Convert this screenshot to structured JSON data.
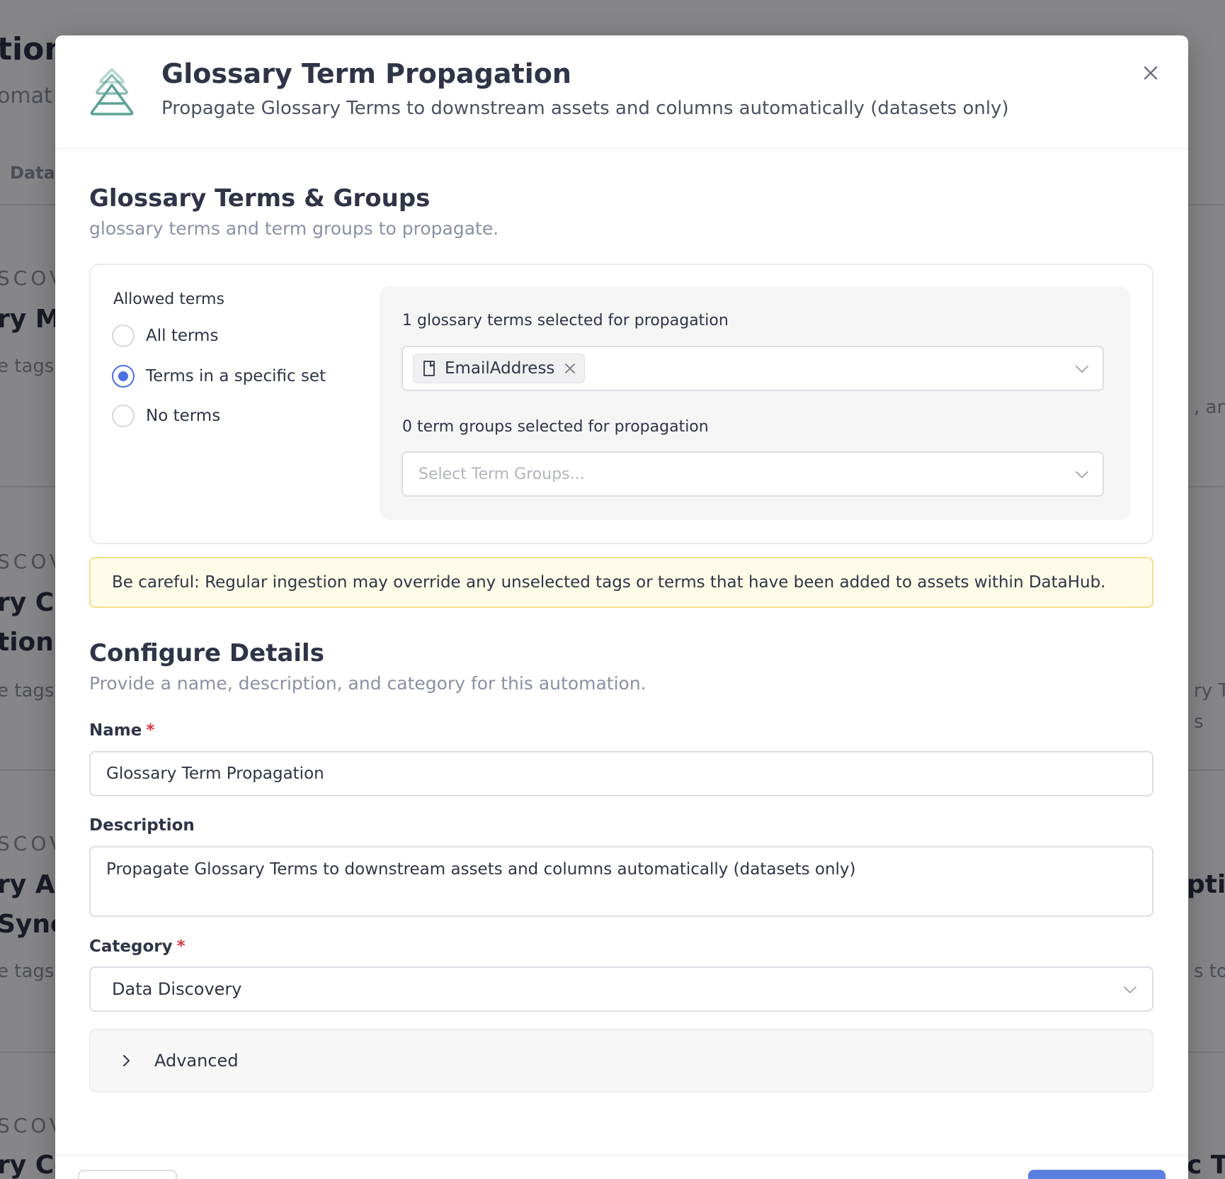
{
  "background": {
    "fragments": [
      "tions",
      "omat",
      "Data",
      "SCOV",
      "ry M",
      "e tags,",
      ", and",
      "SCOV",
      "ry C",
      "tion",
      "e tags,",
      "ry Te",
      "s",
      "SCOV",
      "ry Al",
      "Sync",
      "e tags,",
      "ptio",
      "s to",
      "SCOV",
      "ry Co",
      "c To"
    ]
  },
  "modal": {
    "title": "Glossary Term Propagation",
    "subtitle": "Propagate Glossary Terms to downstream assets and columns automatically (datasets only)",
    "icons": {
      "logo": "layered-triangle-logo",
      "close": "close-icon"
    }
  },
  "terms_section": {
    "title": "Glossary Terms & Groups",
    "subtitle": "glossary terms and term groups to propagate.",
    "allowed_label": "Allowed terms",
    "options": [
      {
        "label": "All terms",
        "checked": false
      },
      {
        "label": "Terms in a specific set",
        "checked": true
      },
      {
        "label": "No terms",
        "checked": false
      }
    ],
    "terms_label": "1 glossary terms selected for propagation",
    "selected_terms": [
      {
        "label": "EmailAddress",
        "icon": "document-icon"
      }
    ],
    "groups_label": "0 term groups selected for propagation",
    "groups_placeholder": "Select Term Groups..."
  },
  "warning": "Be careful: Regular ingestion may override any unselected tags or terms that have been added to assets within DataHub.",
  "details": {
    "title": "Configure Details",
    "subtitle": "Provide a name, description, and category for this automation.",
    "name_label": "Name",
    "name_value": "Glossary Term Propagation",
    "description_label": "Description",
    "description_value": "Propagate Glossary Terms to downstream assets and columns automatically (datasets only)",
    "category_label": "Category",
    "category_value": "Data Discovery",
    "required_marker": "*",
    "advanced_label": "Advanced"
  },
  "colors": {
    "accent": "#4d70e0",
    "required": "#d9363e",
    "warning_bg": "#fefbe8",
    "warning_border": "#f3de8a",
    "logo": "#5aa396"
  }
}
